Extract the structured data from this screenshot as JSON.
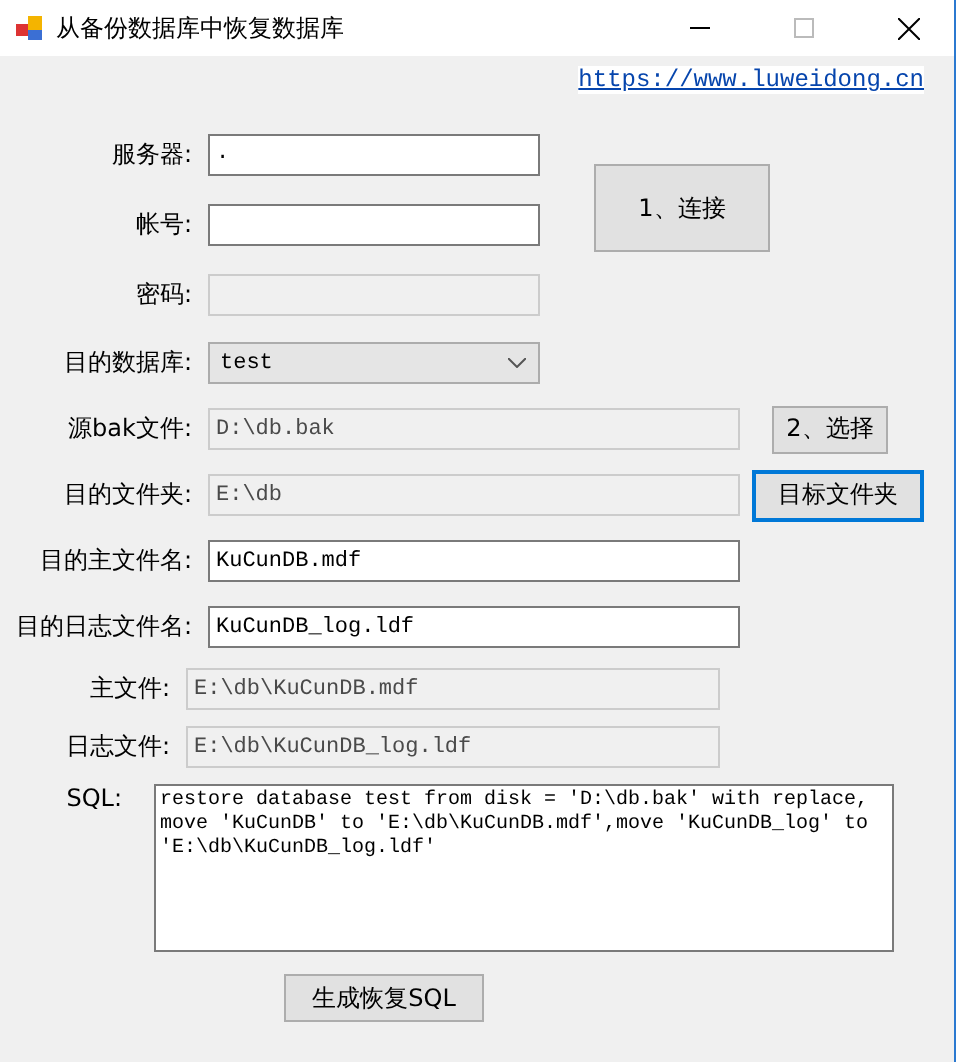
{
  "window": {
    "title": "从备份数据库中恢复数据库"
  },
  "link": "https://www.luweidong.cn",
  "login": {
    "rows": [
      {
        "label": "服务器:",
        "value": ".",
        "enabled": true
      },
      {
        "label": "帐号:",
        "enabled": true
      },
      {
        "label": "密码:",
        "enabled": false
      }
    ],
    "connect_button": "1、连接"
  },
  "rows": [
    {
      "kind": "select",
      "label": "目的数据库:",
      "value": "test",
      "enabled": true
    },
    {
      "kind": "path",
      "label": "源bak文件:",
      "value": "D:\\db.bak",
      "enabled": false,
      "button": {
        "label": "2、选择",
        "focused": false
      }
    },
    {
      "kind": "path",
      "label": "目的文件夹:",
      "value": "E:\\db",
      "enabled": false,
      "button": {
        "label": "目标文件夹",
        "focused": true
      }
    },
    {
      "kind": "path",
      "label": "目的主文件名:",
      "value": "KuCunDB.mdf",
      "enabled": true
    },
    {
      "kind": "path",
      "label": "目的日志文件名:",
      "value": "KuCunDB_log.ldf",
      "enabled": true
    },
    {
      "kind": "result",
      "label": "主文件:",
      "value": "E:\\db\\KuCunDB.mdf",
      "enabled": false
    },
    {
      "kind": "result",
      "label": "日志文件:",
      "value": "E:\\db\\KuCunDB_log.ldf",
      "enabled": false
    }
  ],
  "sql": {
    "label": "SQL:",
    "value": "restore database test from disk = 'D:\\db.bak' with replace, move 'KuCunDB' to 'E:\\db\\KuCunDB.mdf',move 'KuCunDB_log' to 'E:\\db\\KuCunDB_log.ldf'"
  },
  "generate_button": "生成恢复SQL"
}
